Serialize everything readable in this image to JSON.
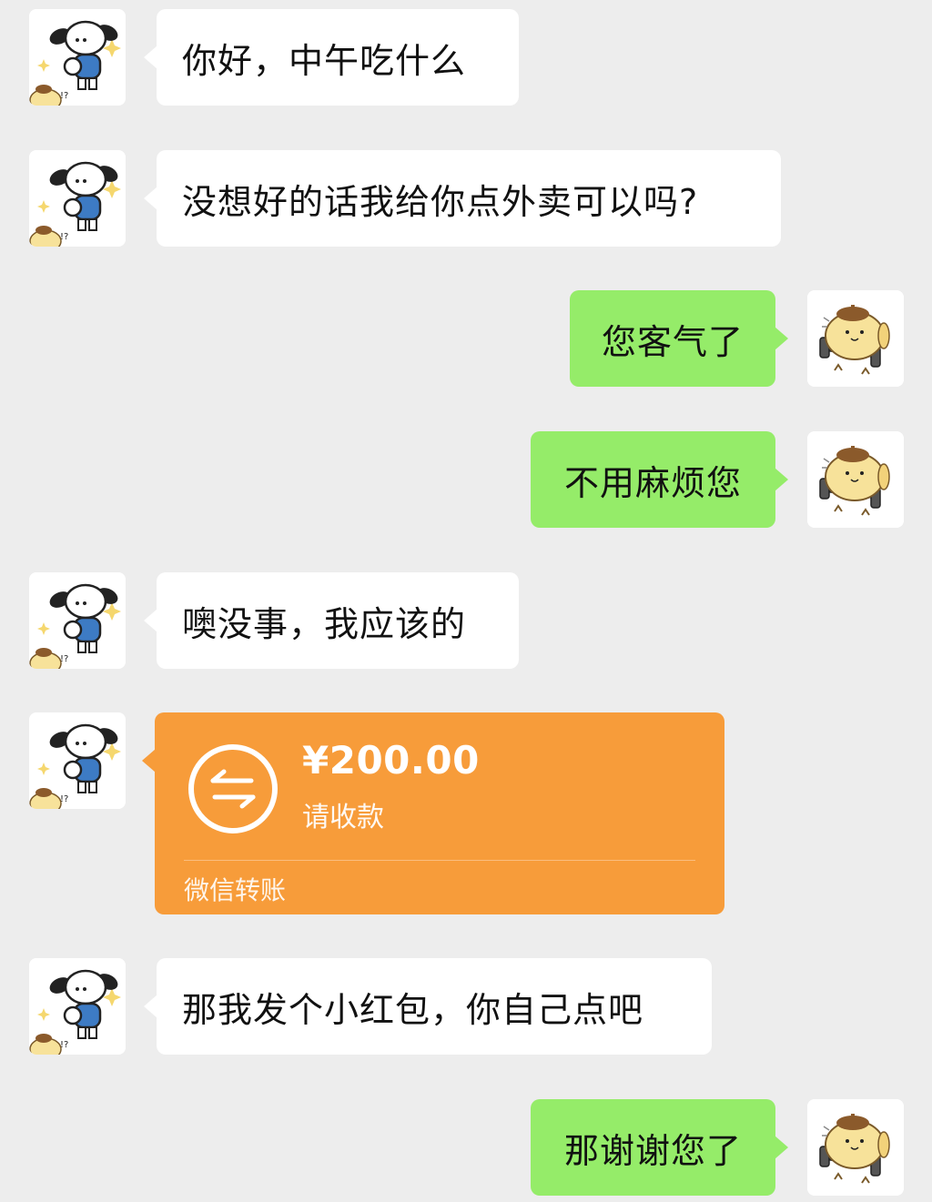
{
  "chat": {
    "messages": [
      {
        "side": "left",
        "text": "你好，中午吃什么"
      },
      {
        "side": "left",
        "text": "没想好的话我给你点外卖可以吗?"
      },
      {
        "side": "right",
        "text": "您客气了"
      },
      {
        "side": "right",
        "text": "不用麻烦您"
      },
      {
        "side": "left",
        "text": "噢没事，我应该的"
      },
      {
        "side": "left",
        "type": "transfer"
      },
      {
        "side": "left",
        "text": "那我发个小红包，你自己点吧"
      },
      {
        "side": "right",
        "text": "那谢谢您了"
      }
    ],
    "transfer": {
      "amount": "¥200.00",
      "note": "请收款",
      "footer": "微信转账"
    }
  },
  "avatars": {
    "contact": "dog-character-avatar",
    "self": "pudding-dog-character-avatar"
  },
  "colors": {
    "background": "#ededed",
    "incoming_bubble": "#ffffff",
    "outgoing_bubble": "#95ec69",
    "transfer_card": "#f79c3a"
  }
}
